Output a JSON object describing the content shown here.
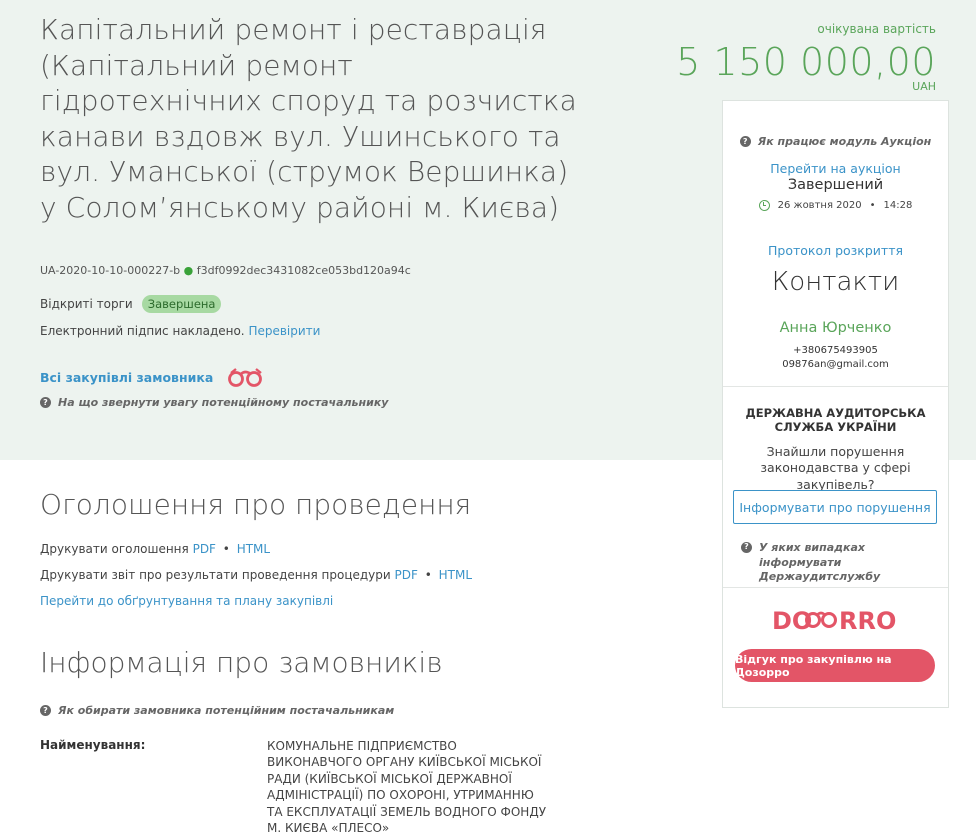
{
  "tender": {
    "title": "Капітальний ремонт і реставрація (Капітальний ремонт гідротехнічних споруд та розчистка канави вздовж вул. Ушинського та вул. Уманської (струмок Вершинка) у Солом’янському районі м. Києва)",
    "id": "UA-2020-10-10-000227-b",
    "hash": "f3df0992dec3431082ce053bd120a94c",
    "procedure": "Відкриті торги",
    "status": "Завершена",
    "signature_text": "Електронний підпис накладено.",
    "verify_link": "Перевірити",
    "all_buys_link": "Всі закупівлі замовника",
    "hint_supplier": "На що звернути увагу потенційному постачальнику"
  },
  "price": {
    "label": "очікувана вартість",
    "value": "5 150 000,00",
    "currency": "UAH"
  },
  "auction": {
    "hint": "Як працює модуль Аукціон",
    "link": "Перейти на аукціон",
    "status": "Завершений",
    "date": "26 жовтня 2020",
    "sep": "•",
    "time": "14:28",
    "protocol_link": "Протокол розкриття"
  },
  "contacts": {
    "heading": "Контакти",
    "name": "Анна Юрченко",
    "phone": "+380675493905",
    "email": "09876an@gmail.com"
  },
  "audit": {
    "title": "ДЕРЖАВНА АУДИТОРСЬКА СЛУЖБА УКРАЇНИ",
    "question": "Знайшли порушення законодавства у сфері закупівель?",
    "button": "Інформувати про порушення",
    "hint": "У яких випадках інформувати Держаудитслужбу"
  },
  "dozorro": {
    "logo_text": "DOZORRO",
    "button": "Відгук про закупівлю на Дозорро"
  },
  "announcement": {
    "heading": "Оголошення про проведення",
    "print_label": "Друкувати оголошення",
    "report_label": "Друкувати звіт про результати проведення процедури",
    "pdf": "PDF",
    "html": "HTML",
    "bullet": "•",
    "plan_link": "Перейти до обґрунтування та плану закупівлі"
  },
  "customer": {
    "heading": "Інформація про замовників",
    "hint": "Як обирати замовника потенційним постачальникам",
    "name_label": "Найменування:",
    "name_value": "Комунальне підприємство ВИКОНАВЧОГО ОРГАНУ КИЇВСЬКОЇ МІСЬКОЇ РАДИ (КИЇВСЬКОЇ МІСЬКОЇ ДЕРЖАВНОЇ АДМІНІСТРАЦІЇ) ПО ОХОРОНІ, УТРИМАННЮ ТА ЕКСПЛУАТАЦІЇ ЗЕМЕЛЬ ВОДНОГО ФОНДУ М. КИЄВА «ПЛЕСО»"
  },
  "icons": {
    "question": "question-circle-icon",
    "binoculars": "binoculars-icon",
    "clock": "clock-icon"
  },
  "colors": {
    "band_bg": "#edf3ef",
    "link": "#3b93c8",
    "green": "#5aa55a",
    "dozorro": "#e35567"
  }
}
